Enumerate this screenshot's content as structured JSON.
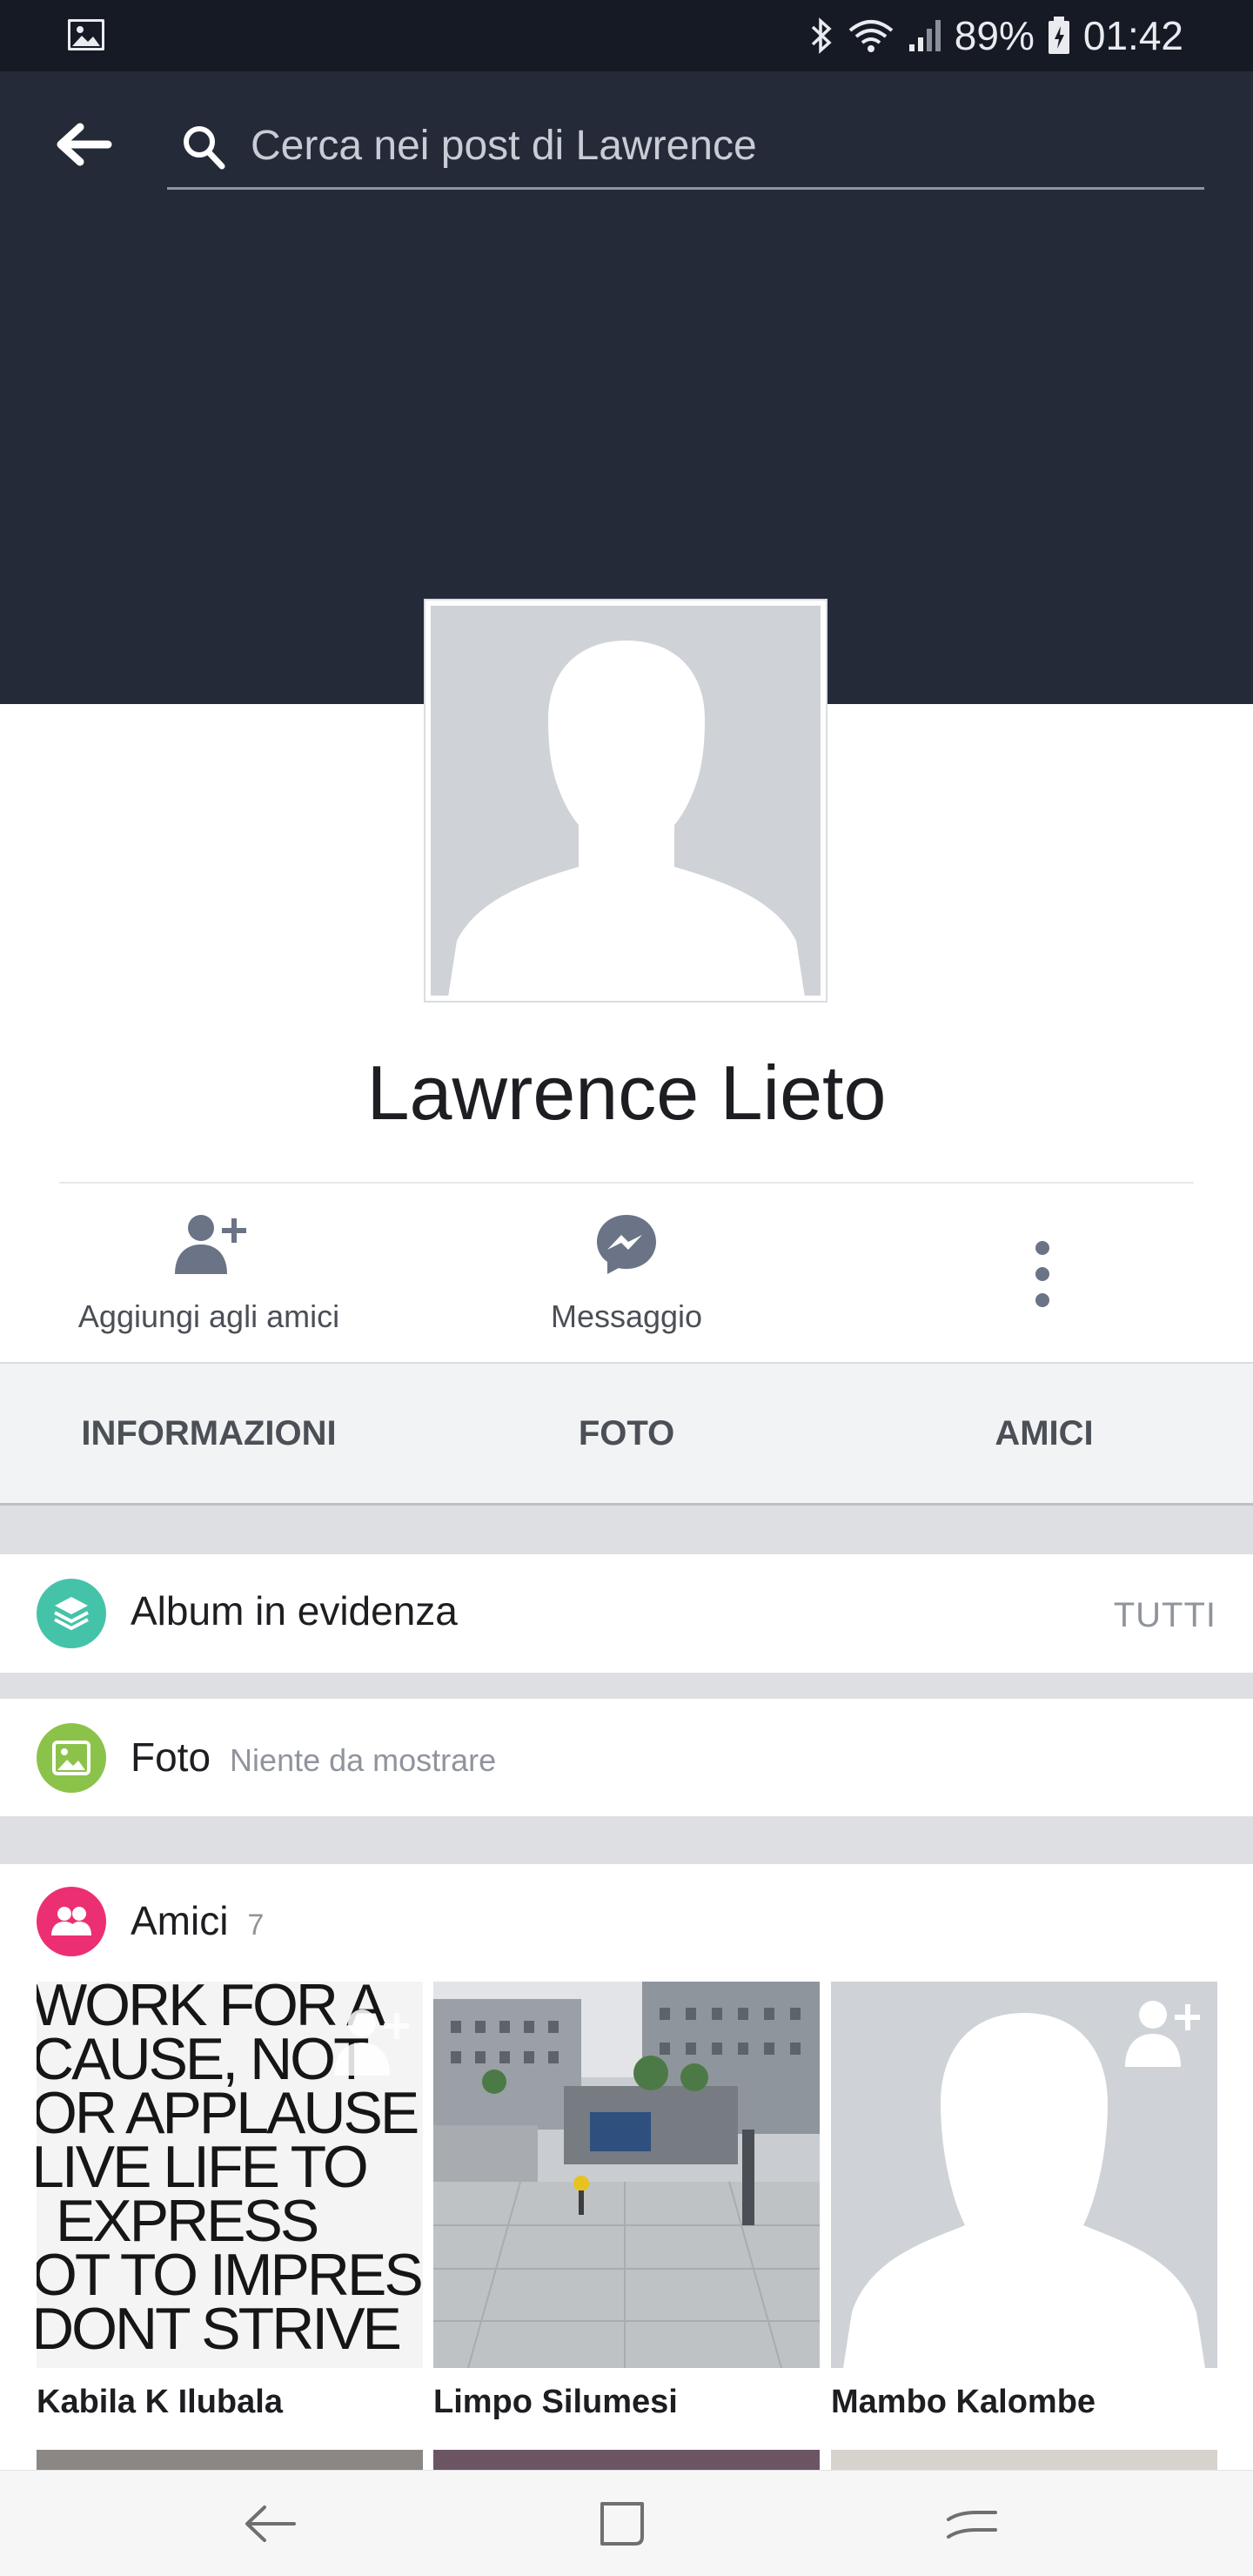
{
  "status_bar": {
    "battery": "89%",
    "time": "01:42"
  },
  "search": {
    "placeholder": "Cerca nei post di Lawrence"
  },
  "profile": {
    "name": "Lawrence Lieto"
  },
  "actions": {
    "add_friend": "Aggiungi agli amici",
    "message": "Messaggio"
  },
  "tabs": [
    "INFORMAZIONI",
    "FOTO",
    "AMICI"
  ],
  "sections": {
    "albums": {
      "title": "Album in evidenza",
      "link": "TUTTI"
    },
    "photos": {
      "title": "Foto",
      "subtitle": "Niente da mostrare"
    },
    "friends": {
      "title": "Amici",
      "count": "7"
    }
  },
  "friends": [
    {
      "name": "Kabila K Ilubala",
      "photo_text": [
        "WORK FOR A",
        "CAUSE, NOT",
        "OR APPLAUSE",
        "LIVE LIFE TO",
        "EXPRESS",
        "OT TO IMPRES",
        "DONT STRIVE"
      ]
    },
    {
      "name": "Limpo Silumesi"
    },
    {
      "name": "Mambo Kalombe"
    }
  ],
  "colors": {
    "header": "#242a38",
    "albums_icon": "#45c3a9",
    "photos_icon": "#8bc34a",
    "friends_icon": "#ec2f73"
  }
}
